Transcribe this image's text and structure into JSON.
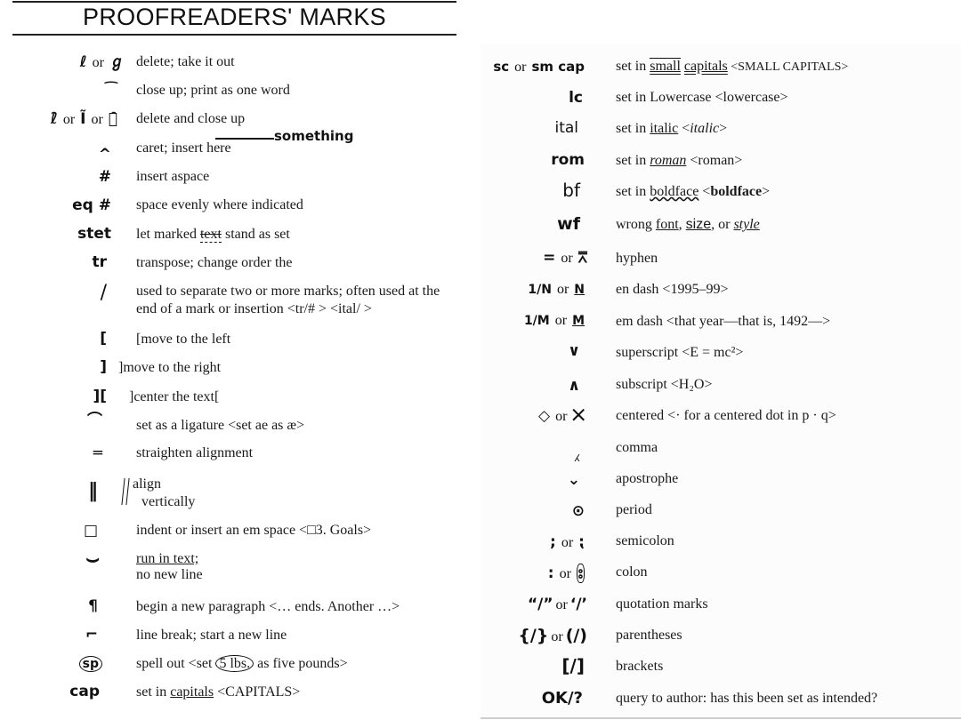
{
  "title": "PROOFREADERS' MARKS",
  "left_column": [
    {
      "mark": "ℓ",
      "or": "or",
      "mark2": "ℊ",
      "desc": "delete; take it out"
    },
    {
      "mark": "⁀",
      "desc": "close up; print as one word"
    },
    {
      "mark": "ℓ̑",
      "or": "or",
      "mark2": "Ĩ",
      "or2": "or",
      "mark3": "ℊ̑",
      "desc": "delete and close up"
    },
    {
      "mark": "^",
      "desc": "caret; insert here",
      "annotation": "something"
    },
    {
      "mark": "#",
      "desc": "insert aspace"
    },
    {
      "mark": "eq #",
      "desc": "space evenly where indicated"
    },
    {
      "mark": "stet",
      "desc_pre": "let marked ",
      "desc_strike": "text",
      "desc_post": " stand as set"
    },
    {
      "mark": "tr",
      "desc": "transpose; change order the"
    },
    {
      "mark": "/",
      "desc": "used to separate two or more marks; often used at the end of a mark or insertion <tr/# > <ital/ >"
    },
    {
      "mark": "[",
      "desc": "[move to the left"
    },
    {
      "mark": "]",
      "desc": "]move to the right"
    },
    {
      "mark": "][",
      "desc": "]center the text["
    },
    {
      "mark": "⌒",
      "desc": "set as a ligature <set ae as æ>"
    },
    {
      "mark": "═",
      "desc": "straighten alignment"
    },
    {
      "mark": "‖",
      "desc_line1": "align",
      "desc_line2": "vertically"
    },
    {
      "mark": "□",
      "desc": "indent or insert an em space <□3. Goals>"
    },
    {
      "mark": "⌣",
      "desc_line1": "run in text;",
      "desc_line2": "no new line"
    },
    {
      "mark": "¶",
      "desc": "begin a new paragraph <… ends. Another …>"
    },
    {
      "mark": "⌐",
      "desc": "line break; start a new line"
    },
    {
      "mark": "sp",
      "desc_pre": "spell out <set ",
      "desc_circle": "5 lbs.",
      "desc_post": " as five pounds>"
    },
    {
      "mark": "cap",
      "desc_pre": "set in ",
      "desc_u": "capitals",
      "desc_post": " <CAPITALS>"
    }
  ],
  "right_column": [
    {
      "mark": "sc",
      "or": "or",
      "mark2": "sm cap",
      "desc_pre": "set in ",
      "desc_u1": "small",
      "desc_u2": "capitals",
      "desc_post": " <SMALL CAPITALS>"
    },
    {
      "mark": "lc",
      "desc": "set in Lowercase <lowercase>"
    },
    {
      "mark": "ital",
      "desc_pre": "set in ",
      "desc_u": "italic",
      "desc_post_it": "italic"
    },
    {
      "mark": "rom",
      "desc_pre": "set in ",
      "desc_u": "roman",
      "desc_post": " <roman>"
    },
    {
      "mark": "bf",
      "desc_pre": "set in ",
      "desc_u": "boldface",
      "desc_post_b": "boldface"
    },
    {
      "mark": "wf",
      "desc_pre": "wrong ",
      "desc_u1": "font",
      "desc_mid1": ", ",
      "desc_u2": "size",
      "desc_mid2": ", or ",
      "desc_u3": "style"
    },
    {
      "mark": "=",
      "or": "or",
      "mark2": "⩞",
      "desc": "hyphen"
    },
    {
      "mark": "1/N",
      "or": "or",
      "mark2": "N",
      "desc": "en dash <1995–99>"
    },
    {
      "mark": "1/M",
      "or": "or",
      "mark2": "M",
      "desc": "em dash <that year—that is, 1492—>"
    },
    {
      "mark": "∨",
      "desc": "superscript <E = mc²>"
    },
    {
      "mark": "∧",
      "desc": "subscript <H₂O>"
    },
    {
      "mark": "◇",
      "or": "or",
      "mark2": "⨉",
      "desc": "centered <· for a centered dot in p · q>"
    },
    {
      "mark": "⁁",
      "desc": "comma"
    },
    {
      "mark": "⌄",
      "desc": "apostrophe"
    },
    {
      "mark": "⊙",
      "desc": "period"
    },
    {
      "mark": ";",
      "or": "or",
      "mark2": "⁏",
      "desc": "semicolon"
    },
    {
      "mark": ":",
      "or": "or",
      "mark2": "⦂",
      "desc": "colon"
    },
    {
      "mark": "“/”",
      "or": "or",
      "mark2": "‘/’",
      "desc": "quotation marks"
    },
    {
      "mark": "{/}",
      "or": "or",
      "mark2": "(/)",
      "desc": "parentheses"
    },
    {
      "mark": "[/]",
      "desc": "brackets"
    },
    {
      "mark": "OK/?",
      "desc": "query to author: has this been set as intended?"
    }
  ]
}
